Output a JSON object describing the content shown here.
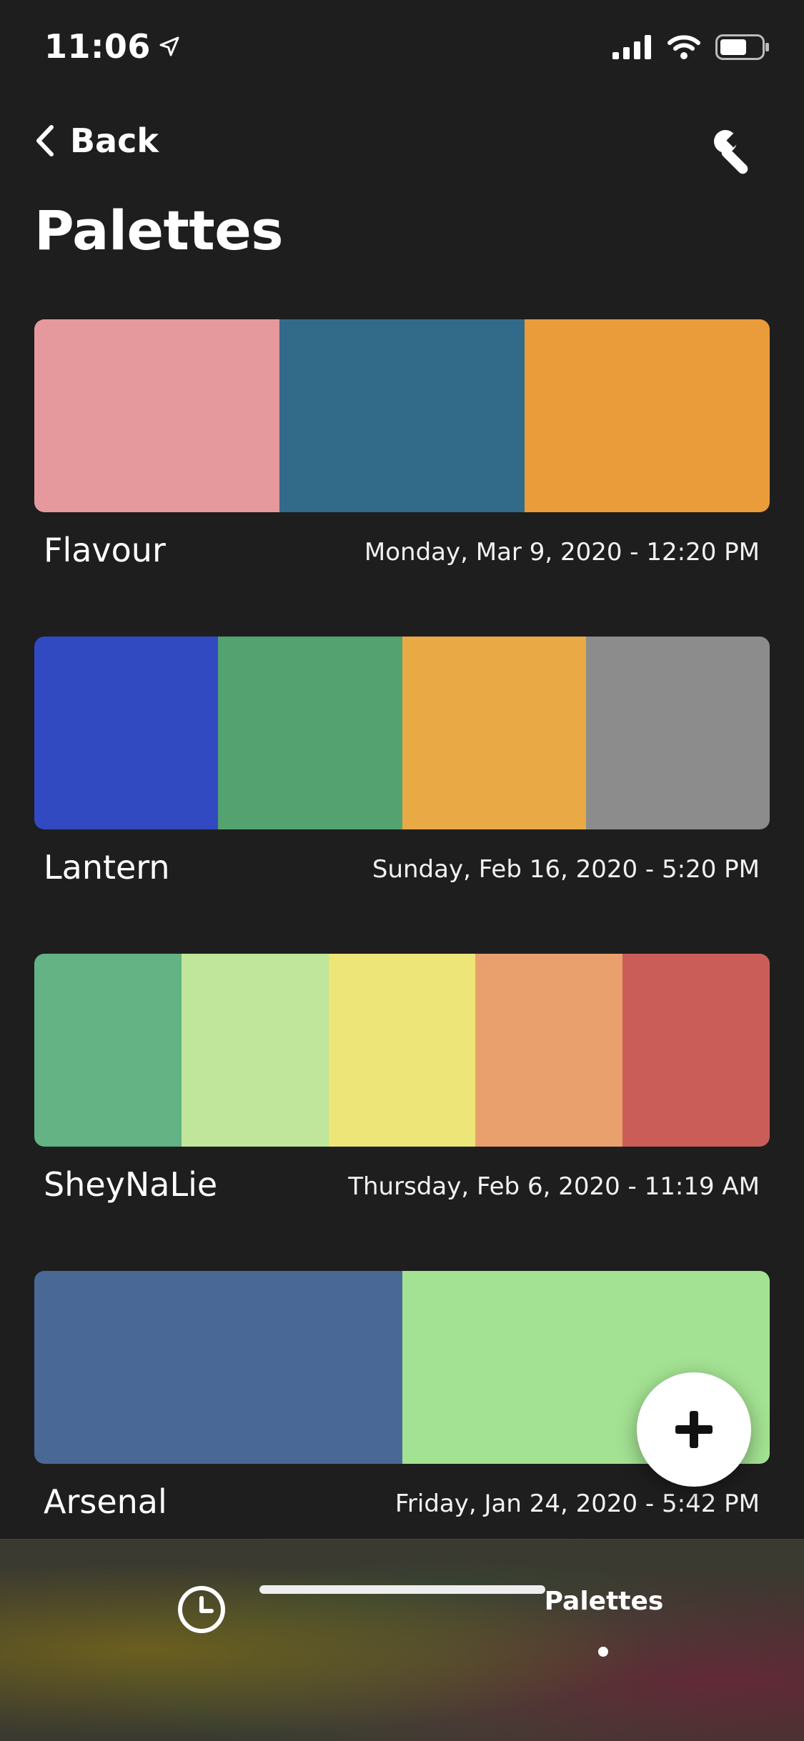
{
  "status_bar": {
    "time": "11:06"
  },
  "nav": {
    "back_label": "Back"
  },
  "page": {
    "title": "Palettes"
  },
  "palettes": [
    {
      "name": "Flavour",
      "date": "Monday, Mar 9, 2020 - 12:20 PM",
      "colors": [
        "#e5999d",
        "#326a8a",
        "#ea9b3a"
      ]
    },
    {
      "name": "Lantern",
      "date": "Sunday, Feb 16, 2020 - 5:20 PM",
      "colors": [
        "#3149c1",
        "#53a26f",
        "#e9a944",
        "#8c8c8c"
      ]
    },
    {
      "name": "SheyNaLie",
      "date": "Thursday, Feb 6, 2020 - 11:19 AM",
      "colors": [
        "#63b384",
        "#bfe69a",
        "#ede577",
        "#e9a06c",
        "#cb5d59"
      ]
    },
    {
      "name": "Arsenal",
      "date": "Friday, Jan 24, 2020 - 5:42 PM",
      "colors": [
        "#4a6896",
        "#a3e292"
      ]
    }
  ],
  "tab_bar": {
    "active_tab_label": "Palettes"
  },
  "icons": {
    "back": "chevron-left-icon",
    "tools": "wrench-icon",
    "add": "plus-icon",
    "history": "clock-icon",
    "location": "location-arrow-icon",
    "signal": "cellular-signal-icon",
    "wifi": "wifi-icon",
    "battery": "battery-icon"
  },
  "colors": {
    "background": "#1e1e1e",
    "text": "#ffffff"
  }
}
